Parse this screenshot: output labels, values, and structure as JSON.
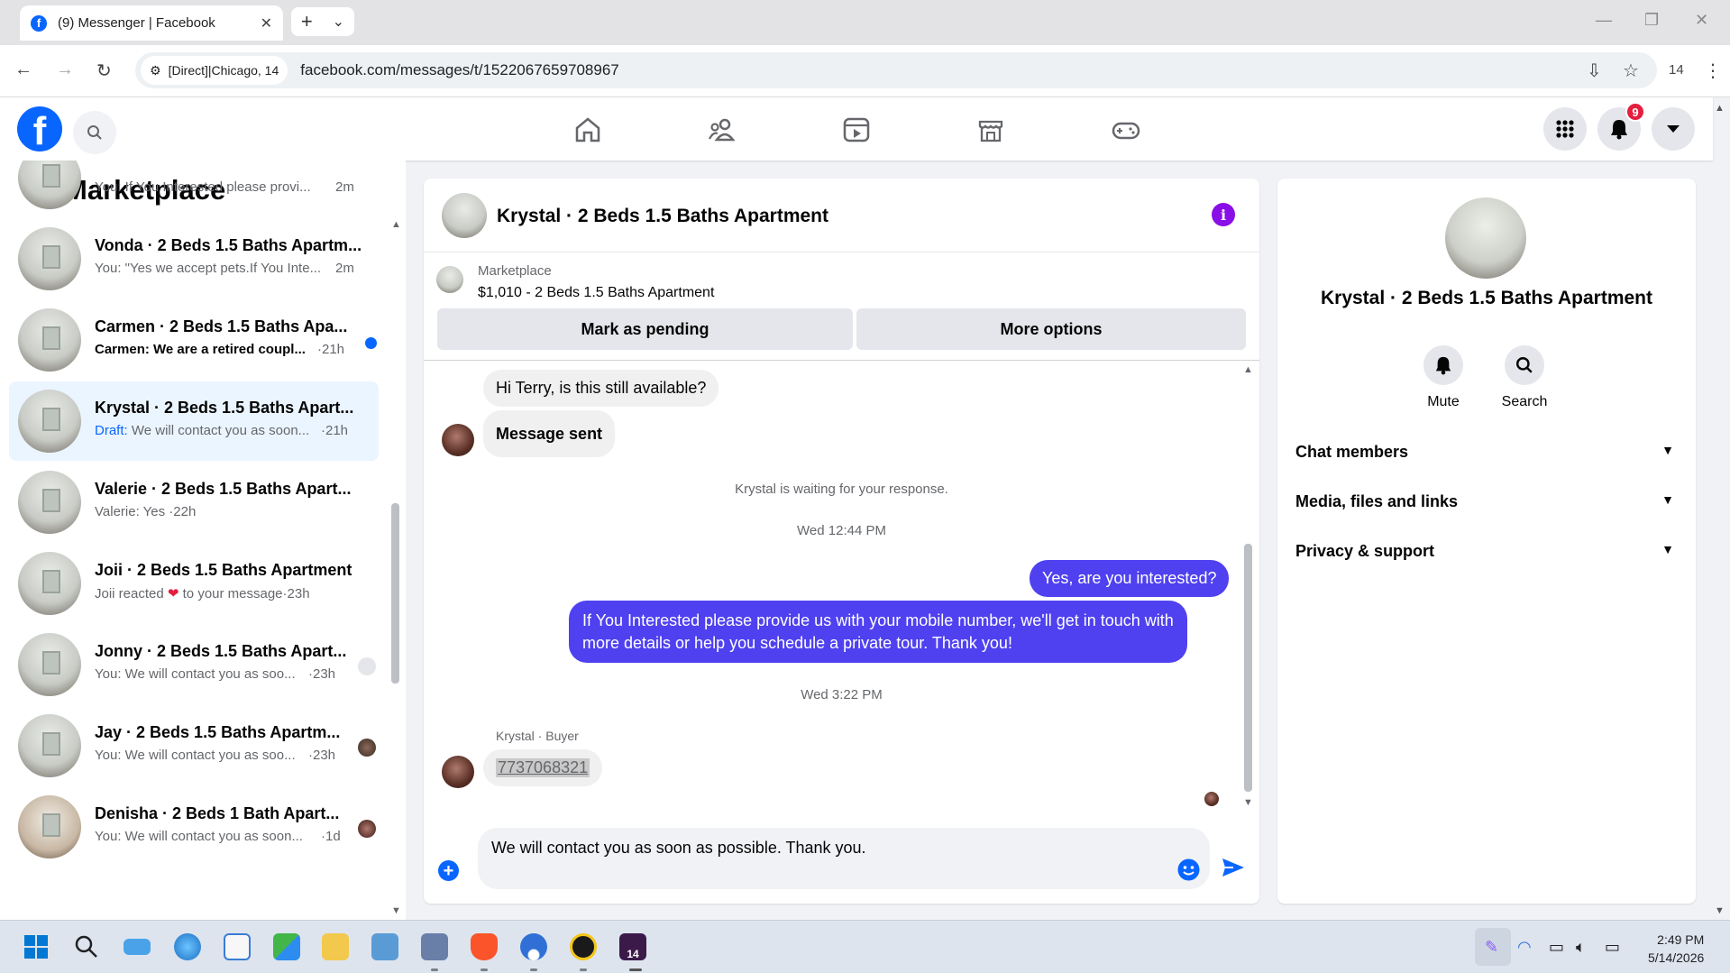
{
  "browser": {
    "tab_title": "(9) Messenger | Facebook",
    "tab_close": "✕",
    "new_tab": "+",
    "tab_menu": "⌄",
    "site_chip": "[Direct]|Chicago, 14",
    "url": "facebook.com/messages/t/1522067659708967",
    "profile_label": "14"
  },
  "fb": {
    "logo_letter": "f",
    "notification_count": "9"
  },
  "sidebar": {
    "title": "Marketplace",
    "conversations": [
      {
        "name": "",
        "snippet": "You: If You Interested please provi...",
        "time": "2m"
      },
      {
        "name": "Vonda · 2 Beds 1.5 Baths Apartm...",
        "snippet": "You: \"Yes we accept pets.If You Inte...",
        "time": "2m"
      },
      {
        "name": "Carmen · 2 Beds 1.5 Baths Apa...",
        "snippet": "Carmen: We are a retired coupl...",
        "time": "·21h"
      },
      {
        "name": "Krystal · 2 Beds 1.5 Baths Apart...",
        "draft_label": "Draft:",
        "snippet": "We will contact you as soon...",
        "time": "·21h"
      },
      {
        "name": "Valerie · 2 Beds 1.5 Baths Apart...",
        "snippet": "Valerie: Yes ·22h",
        "time": ""
      },
      {
        "name": "Joii · 2 Beds 1.5 Baths Apartment",
        "snippet_a": "Joii reacted",
        "snippet_b": "to your message",
        "time": "·23h"
      },
      {
        "name": "Jonny · 2 Beds 1.5 Baths Apart...",
        "snippet": "You: We will contact you as soo...",
        "time": "·23h"
      },
      {
        "name": "Jay · 2 Beds 1.5 Baths Apartm...",
        "snippet": "You: We will contact you as soo...",
        "time": "·23h"
      },
      {
        "name": "Denisha · 2 Beds 1 Bath Apart...",
        "snippet": "You: We will contact you as soon...",
        "time": "·1d"
      }
    ]
  },
  "conversation": {
    "title": "Krystal · 2 Beds 1.5 Baths Apartment",
    "marketplace_label": "Marketplace",
    "listing": "$1,010 - 2 Beds 1.5 Baths Apartment",
    "mark_pending": "Mark as pending",
    "more_options": "More options",
    "messages": {
      "m1": "Hi Terry, is this still available?",
      "m2": "Message sent",
      "waiting": "Krystal is waiting for your response.",
      "ts1": "Wed 12:44 PM",
      "m3": "Yes, are you interested?",
      "m4_l1": "If You Interested please provide us with your mobile number, we'll get in touch with",
      "m4_l2": "more details or help you schedule a private tour. Thank you!",
      "ts2": "Wed 3:22 PM",
      "sender_label": "Krystal · Buyer",
      "m5": "7737068321"
    },
    "composer_text": "We will contact you as soon as possible. Thank you."
  },
  "info_panel": {
    "title": "Krystal · 2 Beds 1.5 Baths Apartment",
    "mute": "Mute",
    "search": "Search",
    "sections": [
      "Chat members",
      "Media, files and links",
      "Privacy & support"
    ]
  },
  "taskbar": {
    "time": "2:49 PM",
    "date": "5/14/2026",
    "badge": "14"
  },
  "colors": {
    "fb_blue": "#0866ff",
    "outgoing_bubble": "#4f41f0",
    "info_purple": "#8a0ee6",
    "notification_red": "#e41e3f"
  }
}
